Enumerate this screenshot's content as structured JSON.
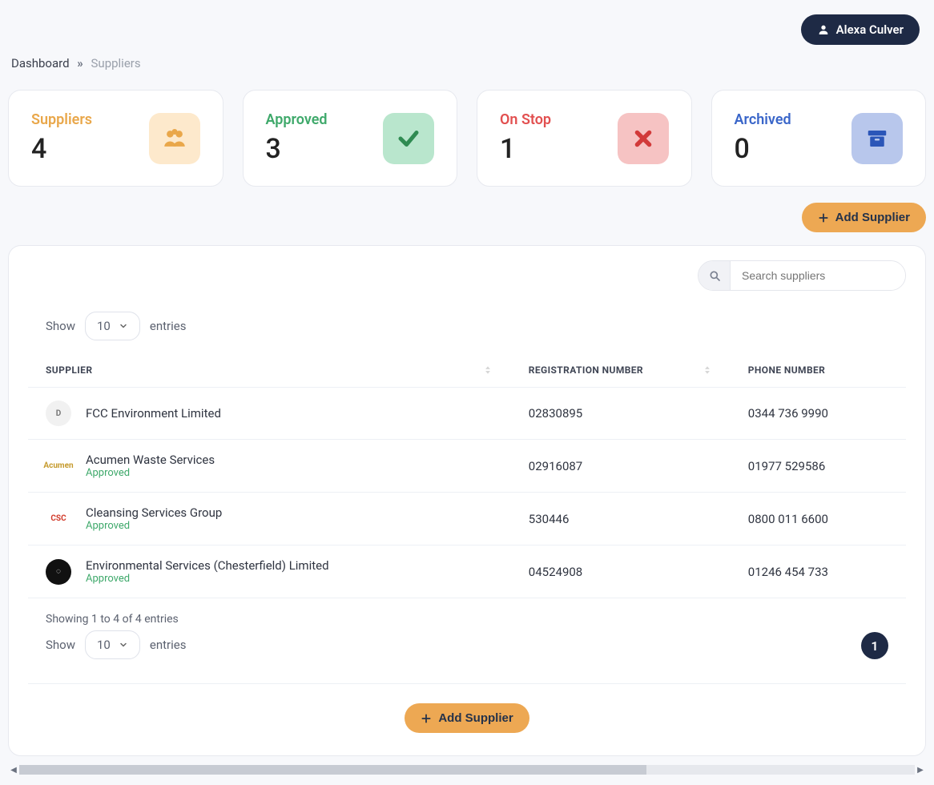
{
  "user": {
    "name": "Alexa Culver"
  },
  "breadcrumb": {
    "root": "Dashboard",
    "current": "Suppliers"
  },
  "stats": {
    "suppliers": {
      "title": "Suppliers",
      "count": "4"
    },
    "approved": {
      "title": "Approved",
      "count": "3"
    },
    "onstop": {
      "title": "On Stop",
      "count": "1"
    },
    "archived": {
      "title": "Archived",
      "count": "0"
    }
  },
  "buttons": {
    "add_supplier": "Add Supplier"
  },
  "search": {
    "placeholder": "Search suppliers"
  },
  "page_size": {
    "show": "Show",
    "value": "10",
    "entries": "entries"
  },
  "table": {
    "headers": {
      "supplier": "SUPPLIER",
      "reg": "REGISTRATION NUMBER",
      "phone": "PHONE NUMBER"
    },
    "rows": [
      {
        "name": "FCC Environment Limited",
        "status": "",
        "reg": "02830895",
        "phone": "0344 736 9990",
        "logo_bg": "#f1f1f1",
        "logo_fg": "#777",
        "logo_text": "D"
      },
      {
        "name": "Acumen Waste Services",
        "status": "Approved",
        "reg": "02916087",
        "phone": "01977 529586",
        "logo_bg": "#ffffff",
        "logo_fg": "#c59a2d",
        "logo_text": "Acumen"
      },
      {
        "name": "Cleansing Services Group",
        "status": "Approved",
        "reg": "530446",
        "phone": "0800 011 6600",
        "logo_bg": "#ffffff",
        "logo_fg": "#d23a2a",
        "logo_text": "CSC"
      },
      {
        "name": "Environmental Services (Chesterfield) Limited",
        "status": "Approved",
        "reg": "04524908",
        "phone": "01246 454 733",
        "logo_bg": "#111",
        "logo_fg": "#fff",
        "logo_text": "◌"
      }
    ]
  },
  "footer": {
    "showing": "Showing 1 to 4 of 4 entries",
    "page": "1"
  }
}
